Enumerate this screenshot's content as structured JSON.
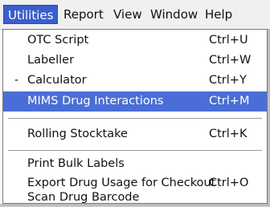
{
  "menubar": {
    "items": [
      {
        "label": "Utilities"
      },
      {
        "label": "Report"
      },
      {
        "label": "View"
      },
      {
        "label": "Window"
      },
      {
        "label": "Help"
      }
    ]
  },
  "dropdown": {
    "items": [
      {
        "label": "OTC Script",
        "shortcut": "Ctrl+U"
      },
      {
        "label": "Labeller",
        "shortcut": "Ctrl+W"
      },
      {
        "label": "Calculator",
        "shortcut": "Ctrl+Y",
        "mark": "-"
      },
      {
        "label": "MIMS Drug Interactions",
        "shortcut": "Ctrl+M",
        "highlighted": true
      },
      {
        "label": "Rolling Stocktake",
        "shortcut": "Ctrl+K"
      },
      {
        "label": "Print Bulk Labels",
        "shortcut": ""
      },
      {
        "label": "Export Drug Usage for Checkout",
        "shortcut": "Ctrl+O"
      },
      {
        "label": "Scan Drug Barcode",
        "shortcut": ""
      }
    ]
  },
  "colors": {
    "highlight": "#4a6ed6",
    "active_menu": "#3a5fcd"
  }
}
